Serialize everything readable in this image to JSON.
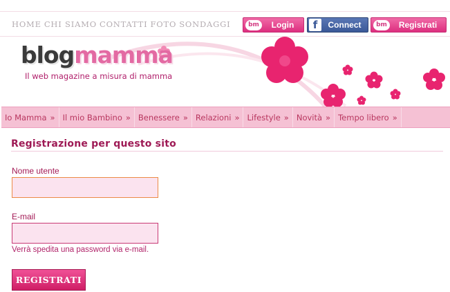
{
  "top_nav": [
    "HOME",
    "CHI SIAMO",
    "CONTATTI",
    "FOTO",
    "SONDAGGI"
  ],
  "auth_buttons": {
    "login": {
      "badge": "bm",
      "label": "Login"
    },
    "connect": {
      "badge": "f",
      "label": "Connect"
    },
    "register": {
      "badge": "bm",
      "label": "Registrati"
    }
  },
  "logo": {
    "part1": "blog",
    "part2": "mamma"
  },
  "tagline": "Il web magazine a misura di mamma",
  "categories": [
    {
      "label": "Io Mamma",
      "arrow": "»"
    },
    {
      "label": "Il mio Bambino",
      "arrow": "»"
    },
    {
      "label": "Benessere",
      "arrow": "»"
    },
    {
      "label": "Relazioni",
      "arrow": "»"
    },
    {
      "label": "Lifestyle",
      "arrow": "»"
    },
    {
      "label": "Novità",
      "arrow": "»"
    },
    {
      "label": "Tempo libero",
      "arrow": "»"
    }
  ],
  "form": {
    "title": "Registrazione per questo sito",
    "username_label": "Nome utente",
    "username_value": "",
    "email_label": "E-mail",
    "email_value": "",
    "hint": "Verrà spedita una password via e-mail.",
    "submit_label": "REGISTRATI"
  },
  "colors": {
    "brand_pink": "#dd2f7f",
    "facebook_blue": "#3b5998",
    "category_bar": "#f5c1d4",
    "title_color": "#9e1a55"
  }
}
